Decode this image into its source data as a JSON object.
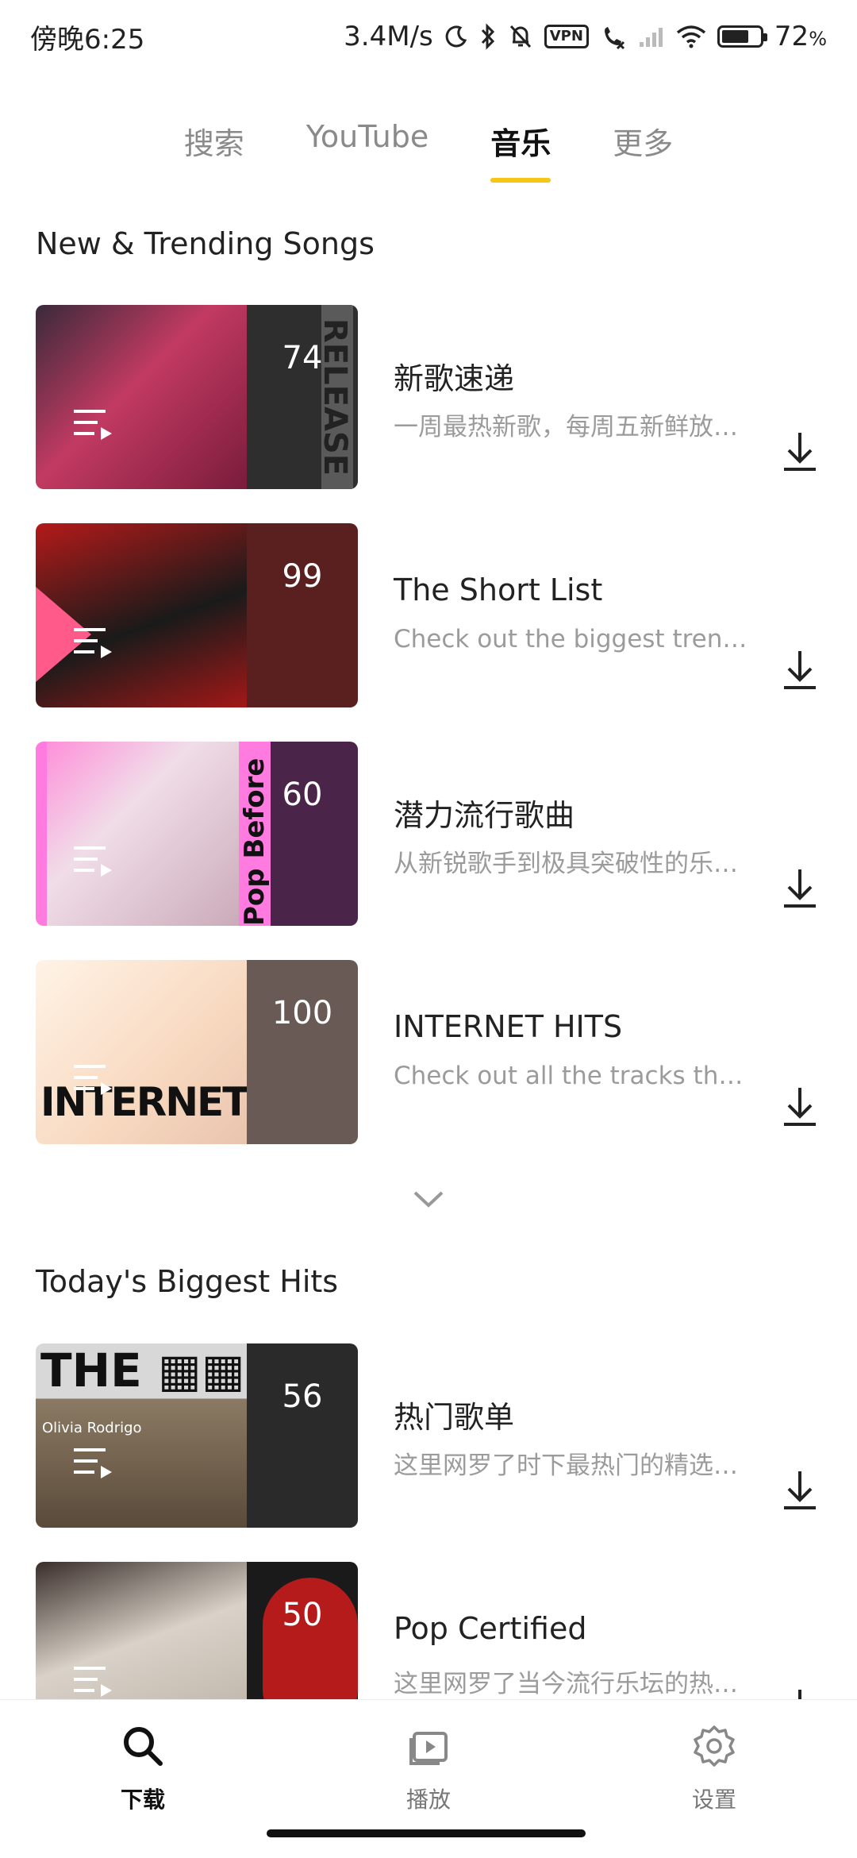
{
  "status_bar": {
    "time": "傍晚6:25",
    "network_speed": "3.4M/s",
    "vpn_label": "VPN",
    "battery_percent": "72",
    "battery_unit": "%",
    "battery_level": 0.72
  },
  "tabs": [
    {
      "label": "搜索",
      "active": false
    },
    {
      "label": "YouTube",
      "active": false
    },
    {
      "label": "音乐",
      "active": true
    },
    {
      "label": "更多",
      "active": false
    }
  ],
  "sections": [
    {
      "title": "New & Trending Songs",
      "items": [
        {
          "title": "新歌速递",
          "subtitle": "一周最热新歌，每周五新鲜放…",
          "count": "74",
          "art_color": "#c23a62",
          "panel_color": "#3b3b3b"
        },
        {
          "title": "The Short List",
          "subtitle": "Check out the biggest tren…",
          "count": "99",
          "art_color": "#a31818",
          "panel_color": "#5a1a1a"
        },
        {
          "title": "潜力流行歌曲",
          "subtitle": "从新锐歌手到极具突破性的乐…",
          "count": "60",
          "art_color": "#e6a6c9",
          "panel_color": "#4b2449"
        },
        {
          "title": "INTERNET HITS",
          "subtitle": "Check out all the tracks th…",
          "count": "100",
          "art_color": "#f5e6d8",
          "panel_color": "#6a5a55"
        }
      ]
    },
    {
      "title": "Today's Biggest Hits",
      "items": [
        {
          "title": "热门歌单",
          "subtitle": "这里网罗了时下最热门的精选…",
          "count": "56",
          "art_color": "#8b7a63",
          "panel_color": "#2a2a2a"
        },
        {
          "title": "Pop Certified",
          "subtitle": "这里网罗了当今流行乐坛的热…",
          "count": "50",
          "art_color": "#d9d2c8",
          "panel_color": "#1a1a1a"
        }
      ]
    }
  ],
  "thumb_text": {
    "release": "RELEASE",
    "internet": "INTERNET",
    "the_list": "THE ▦▦ LIST",
    "olivia": "Olivia Rodrigo",
    "pop_before": "Pop Before Bre"
  },
  "bottom_nav": [
    {
      "label": "下载",
      "icon": "search-icon",
      "active": true
    },
    {
      "label": "播放",
      "icon": "play-video-icon",
      "active": false
    },
    {
      "label": "设置",
      "icon": "settings-gear-icon",
      "active": false
    }
  ],
  "colors": {
    "accent": "#f5c518",
    "text_primary": "#222222",
    "text_secondary": "#9b9b9b"
  }
}
